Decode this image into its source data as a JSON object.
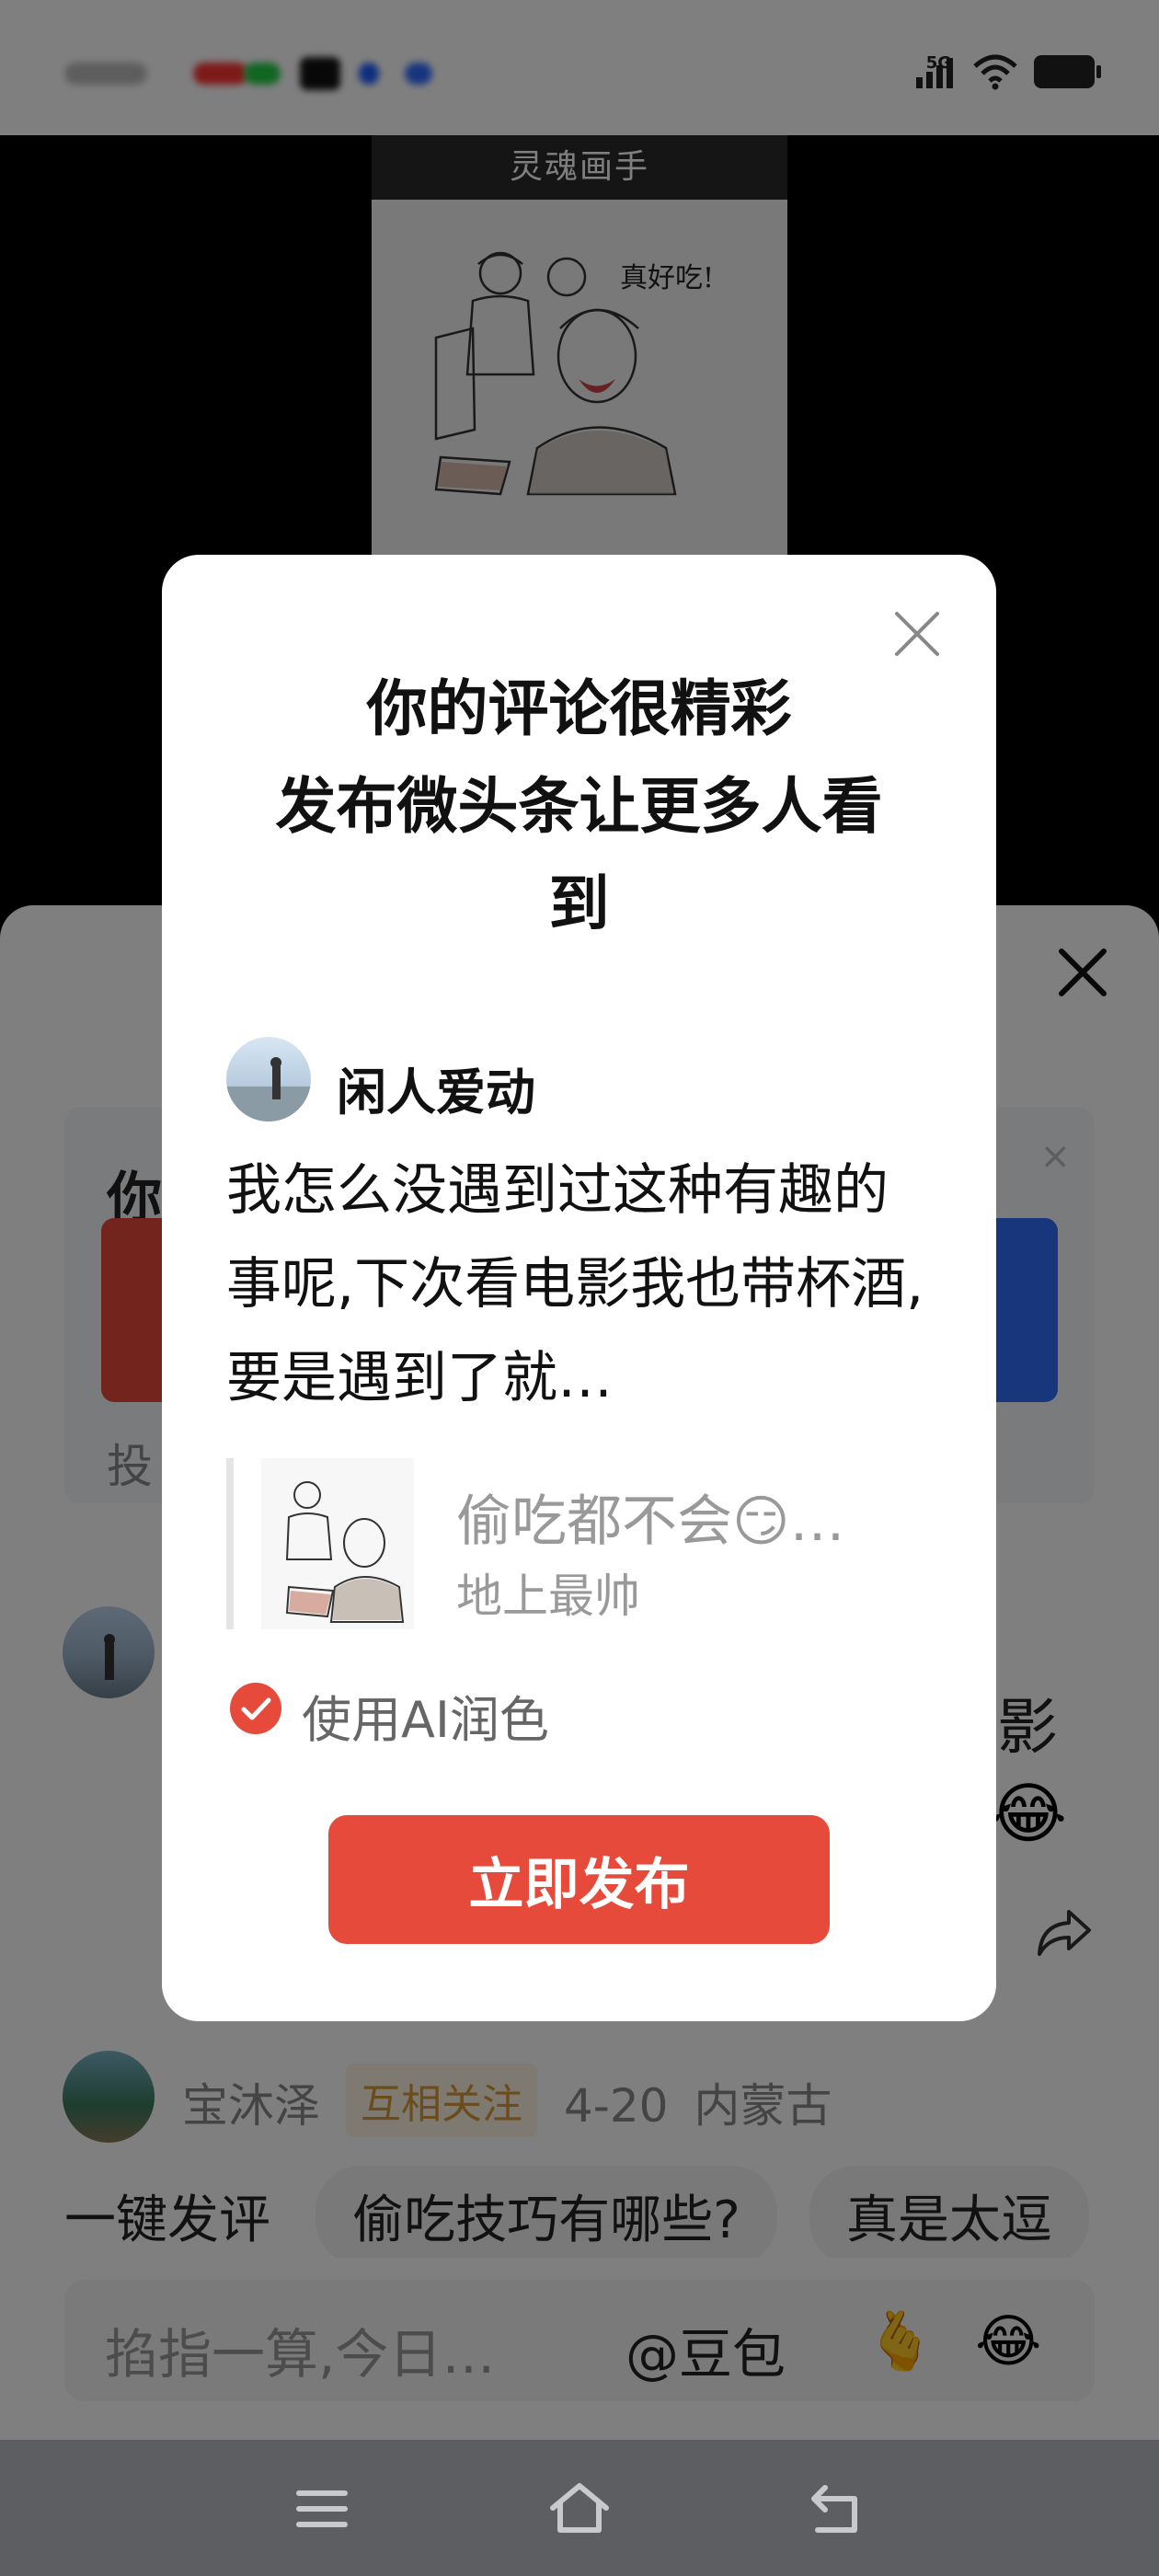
{
  "status_bar": {
    "network": "5G"
  },
  "video": {
    "header_title": "灵魂画手",
    "speech_text": "真好吃!"
  },
  "comments_sheet": {
    "promo": {
      "title_partial": "你",
      "subtitle_partial": "投"
    },
    "comment_tail_line1": "影",
    "comment_emoji": "😂",
    "user2": {
      "name": "宝沐泽",
      "badge": "互相关注",
      "date": "4-20",
      "location": "内蒙古"
    },
    "quick_row": {
      "label": "一键发评",
      "chips": [
        "偷吃技巧有哪些?",
        "真是太逗"
      ]
    },
    "input": {
      "placeholder": "掐指一算,今日…",
      "mention": "@豆包",
      "emoji_1": "🫰",
      "emoji_2": "😂"
    }
  },
  "dialog": {
    "title": "你的评论很精彩\n发布微头条让更多人看\n到",
    "author": "闲人爱动",
    "comment_text": "我怎么没遇到过这种有趣的事呢,下次看电影我也带杯酒,要是遇到了就…",
    "quote": {
      "text": "偷吃都不会😏…",
      "author": "地上最帅"
    },
    "ai_polish_label": "使用AI润色",
    "ai_polish_checked": true,
    "publish_label": "立即发布"
  },
  "colors": {
    "accent": "#e64a3b",
    "blue": "#2e6cf6",
    "badge_text": "#d69a3b"
  },
  "icons": [
    "signal-icon",
    "wifi-icon",
    "battery-icon",
    "close-icon",
    "share-icon",
    "check-icon",
    "menu-icon",
    "home-icon",
    "back-icon"
  ]
}
